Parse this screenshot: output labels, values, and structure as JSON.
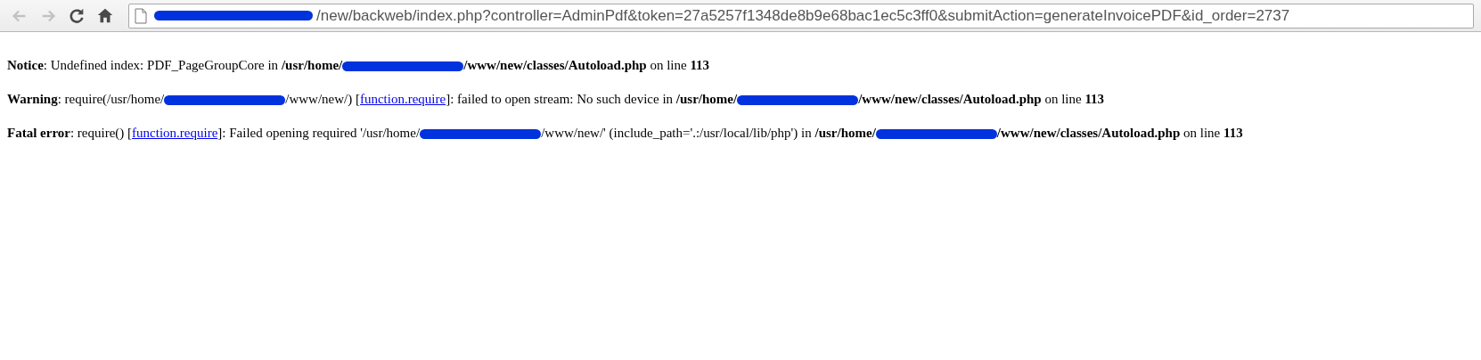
{
  "toolbar": {
    "buttons": [
      {
        "kind": "back",
        "disabled": true
      },
      {
        "kind": "forward",
        "disabled": true
      },
      {
        "kind": "reload",
        "disabled": false
      },
      {
        "kind": "home",
        "disabled": false
      }
    ],
    "address": {
      "redacted_prefix": true,
      "value": "/new/backweb/index.php?controller=AdminPdf&token=27a5257f1348de8b9e68bac1ec5c3ff0&submitAction=generateInvoicePDF&id_order=2737"
    }
  },
  "messages": [
    {
      "segments": [
        {
          "kind": "text",
          "text": "**Notice**: Undefined index: PDF_PageGroupCore in **/usr/home/**"
        },
        {
          "kind": "redaction"
        },
        {
          "kind": "text",
          "text": "**/www/new/classes/Autoload.php** on line **113**"
        }
      ]
    },
    {
      "segments": [
        {
          "kind": "text",
          "text": "**Warning**: require(/usr/home/"
        },
        {
          "kind": "redaction"
        },
        {
          "kind": "text",
          "text": "/www/new/) ["
        },
        {
          "kind": "link",
          "text": "function.require"
        },
        {
          "kind": "text",
          "text": "]: failed to open stream: No such device in **/usr/home/**"
        },
        {
          "kind": "redaction"
        },
        {
          "kind": "text",
          "text": "**/www/new/classes/Autoload.php** on line **113**"
        }
      ]
    },
    {
      "segments": [
        {
          "kind": "text",
          "text": "**Fatal error**: require() ["
        },
        {
          "kind": "link",
          "text": "function.require"
        },
        {
          "kind": "text",
          "text": "]: Failed opening required '/usr/home/"
        },
        {
          "kind": "redaction"
        },
        {
          "kind": "text",
          "text": "/www/new/' (include_path='.:/usr/local/lib/php') in **/usr/home/**"
        },
        {
          "kind": "redaction"
        },
        {
          "kind": "text",
          "text": "**/www/new/classes/Autoload.php** on line **113**"
        }
      ]
    }
  ]
}
